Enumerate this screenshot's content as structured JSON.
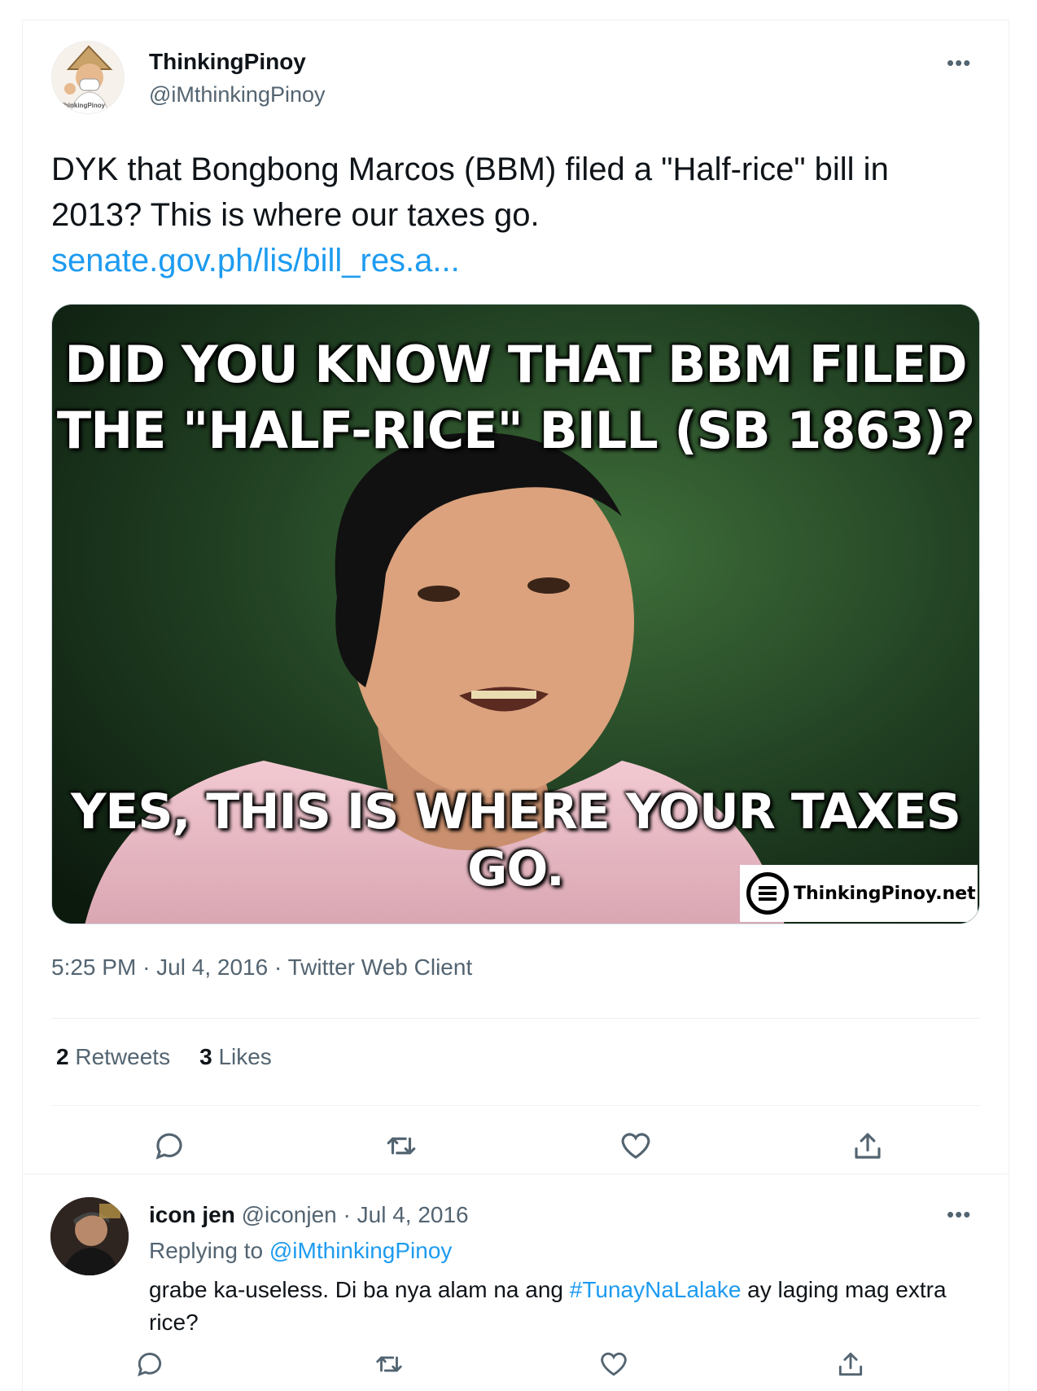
{
  "tweet": {
    "author_name": "ThinkingPinoy",
    "author_handle": "@iMthinkingPinoy",
    "avatar_caption": "ThinkingPinoy",
    "text": "DYK that Bongbong Marcos (BBM) filed a \"Half-rice\" bill in 2013? This is where our taxes go.",
    "link": "senate.gov.ph/lis/bill_res.a...",
    "image": {
      "line1": "DID YOU KNOW THAT BBM FILED",
      "line2": "THE \"HALF-RICE\" BILL (SB 1863)?",
      "line3": "YES, THIS IS WHERE YOUR TAXES GO.",
      "watermark": "ThinkingPinoy.net"
    },
    "time": "5:25 PM",
    "date": "Jul 4, 2016",
    "client": "Twitter Web Client",
    "retweets_count": "2",
    "retweets_label": "Retweets",
    "likes_count": "3",
    "likes_label": "Likes"
  },
  "reply": {
    "author_name": "icon jen",
    "author_handle": "@iconjen",
    "date": "Jul 4, 2016",
    "replying_label": "Replying to",
    "replying_to": "@iMthinkingPinoy",
    "text_before": "grabe ka-useless. Di ba nya alam na ang ",
    "hashtag": "#TunayNaLalake",
    "text_after": " ay laging mag extra rice?"
  },
  "icons": {
    "more": "more-dots-icon",
    "reply": "reply-bubble-icon",
    "retweet": "retweet-icon",
    "like": "heart-icon",
    "share": "share-icon"
  },
  "colors": {
    "accent": "#1d9bf0",
    "secondary_text": "#536471",
    "primary_text": "#0f1419",
    "divider": "#eff3f4"
  }
}
